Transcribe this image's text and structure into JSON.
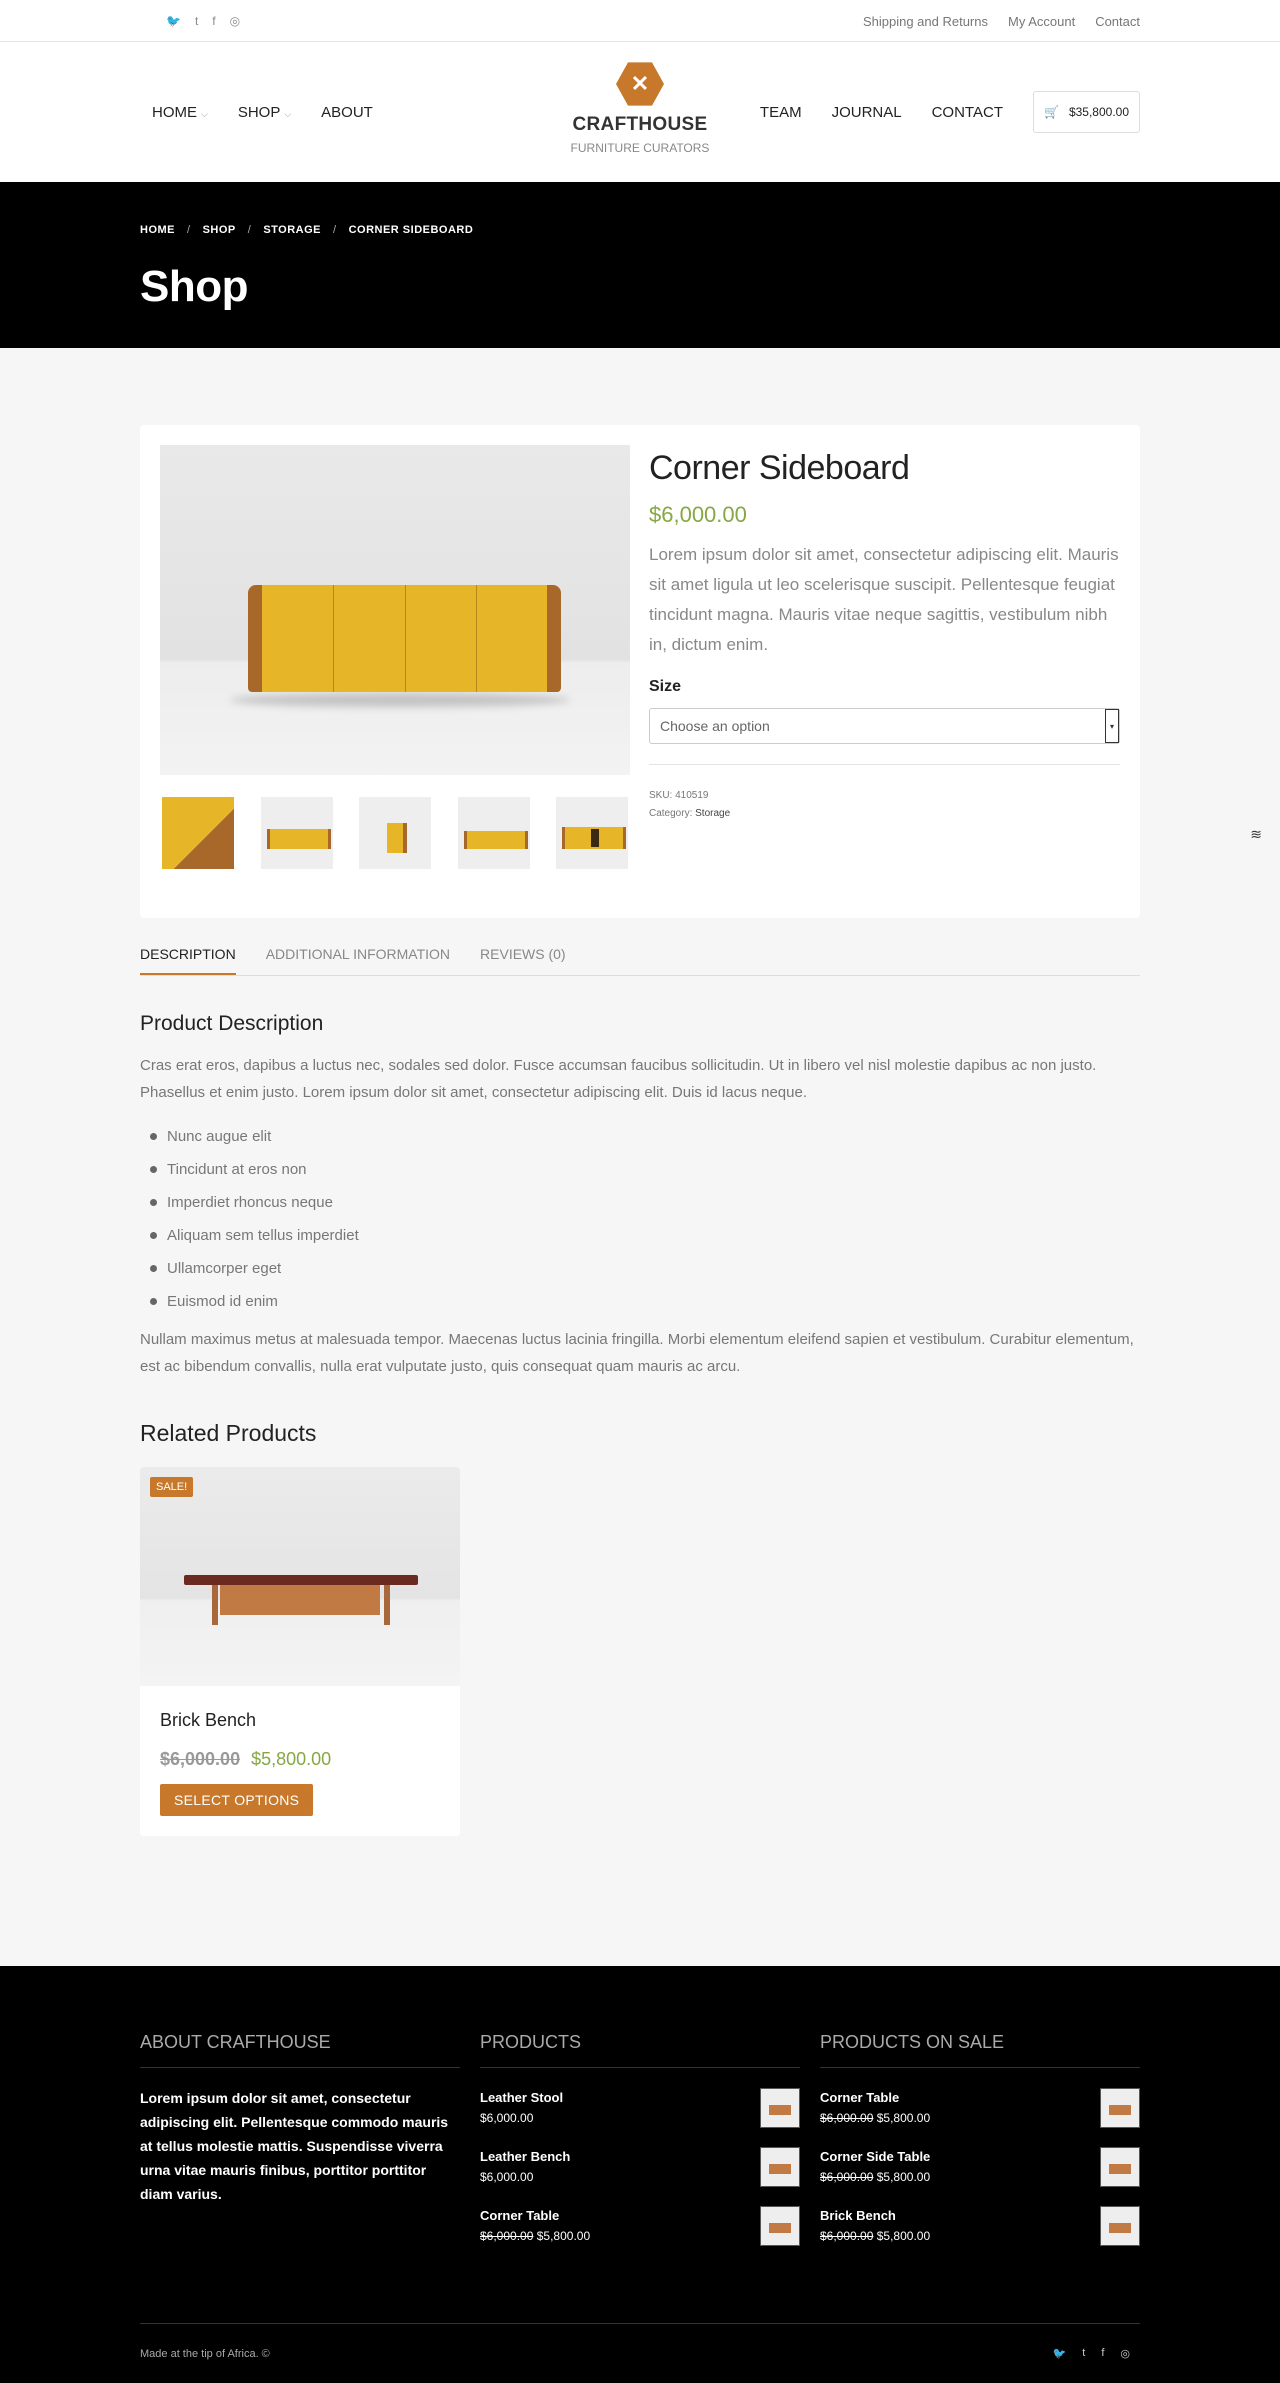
{
  "topbar": {
    "social": [
      "",
      "🐦",
      "t",
      "f",
      "◎"
    ],
    "links": [
      "Shipping and Returns",
      "My Account",
      "Contact"
    ]
  },
  "header": {
    "nav_left": [
      "HOME",
      "SHOP",
      "ABOUT"
    ],
    "nav_right": [
      "TEAM",
      "JOURNAL",
      "CONTACT"
    ],
    "logo_title": "CRAFTHOUSE",
    "logo_sub": "FURNITURE CURATORS",
    "cart_total": "$35,800.00"
  },
  "hero": {
    "breadcrumbs": [
      "HOME",
      "SHOP",
      "STORAGE",
      "CORNER SIDEBOARD"
    ],
    "title": "Shop"
  },
  "product": {
    "name": "Corner Sideboard",
    "price": "$6,000.00",
    "description": "Lorem ipsum dolor sit amet, consectetur adipiscing elit. Mauris sit amet ligula ut leo scelerisque suscipit. Pellentesque feugiat tincidunt magna. Mauris vitae neque sagittis, vestibulum nibh in, dictum enim.",
    "size_label": "Size",
    "select_placeholder": "Choose an option",
    "sku_label": "SKU:",
    "sku": "410519",
    "category_label": "Category:",
    "category": "Storage"
  },
  "tabs": [
    "DESCRIPTION",
    "ADDITIONAL INFORMATION",
    "REVIEWS (0)"
  ],
  "description": {
    "heading": "Product Description",
    "para1": "Cras erat eros, dapibus a luctus nec, sodales sed dolor. Fusce accumsan faucibus sollicitudin. Ut in libero vel nisl molestie dapibus ac non justo. Phasellus et enim justo. Lorem ipsum dolor sit amet, consectetur adipiscing elit. Duis id lacus neque.",
    "bullets": [
      "Nunc augue elit",
      "Tincidunt at eros non",
      "Imperdiet rhoncus neque",
      "Aliquam sem tellus imperdiet",
      "Ullamcorper eget",
      "Euismod id enim"
    ],
    "para2": "Nullam maximus metus at malesuada tempor. Maecenas luctus lacinia fringilla. Morbi elementum eleifend sapien et vestibulum. Curabitur elementum, est ac bibendum convallis, nulla erat vulputate justo, quis consequat quam mauris ac arcu."
  },
  "related": {
    "heading": "Related Products",
    "badge": "SALE!",
    "name": "Brick Bench",
    "old_price": "$6,000.00",
    "new_price": "$5,800.00",
    "button": "SELECT OPTIONS"
  },
  "footer": {
    "about_title": "ABOUT CRAFTHOUSE",
    "about_text": "Lorem ipsum dolor sit amet, consectetur adipiscing elit. Pellentesque commodo mauris at tellus molestie mattis. Suspendisse viverra urna vitae mauris finibus, porttitor porttitor diam varius.",
    "products_title": "PRODUCTS",
    "products": [
      {
        "name": "Leather Stool",
        "price": "$6,000.00"
      },
      {
        "name": "Leather Bench",
        "price": "$6,000.00"
      },
      {
        "name": "Corner Table",
        "old": "$6,000.00",
        "price": "$5,800.00"
      }
    ],
    "sale_title": "PRODUCTS ON SALE",
    "sale": [
      {
        "name": "Corner Table",
        "old": "$6,000.00",
        "price": "$5,800.00"
      },
      {
        "name": "Corner Side Table",
        "old": "$6,000.00",
        "price": "$5,800.00"
      },
      {
        "name": "Brick Bench",
        "old": "$6,000.00",
        "price": "$5,800.00"
      }
    ],
    "copyright": "Made at the tip of Africa. ©",
    "social": [
      "",
      "🐦",
      "t",
      "f",
      "◎"
    ]
  }
}
